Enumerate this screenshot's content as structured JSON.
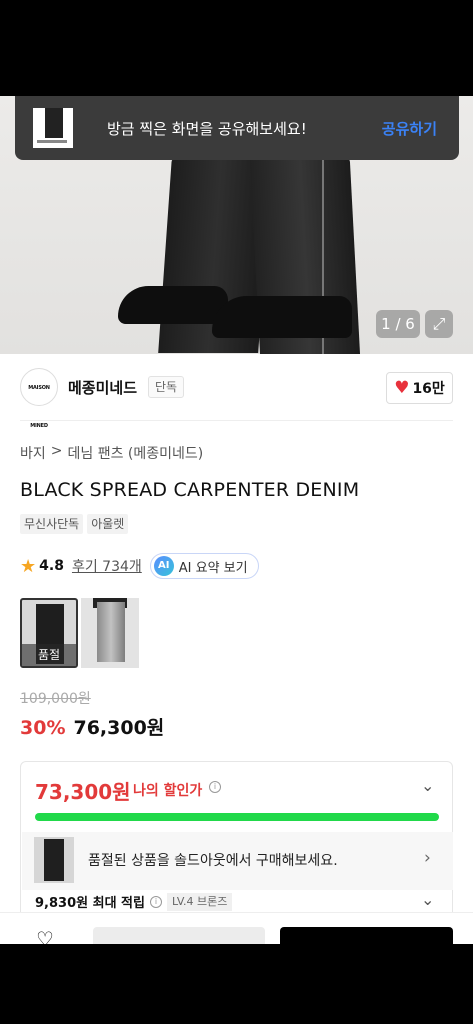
{
  "toast": {
    "message": "방금 찍은 화면을 공유해보세요!",
    "action": "공유하기"
  },
  "gallery": {
    "counter": "1 / 6",
    "expand_icon": "expand-icon"
  },
  "brand": {
    "logo_text": "MAISON MINED",
    "name": "메종미네드",
    "tag": "단독",
    "likes": "16만",
    "heart_color": "#e8323c"
  },
  "breadcrumb": {
    "items": [
      "바지",
      "데님 팬츠 (메종미네드)"
    ],
    "separator": ">"
  },
  "product": {
    "title": "BLACK SPREAD CARPENTER DENIM",
    "badges": [
      "무신사단독",
      "아울렛"
    ],
    "rating": "4.8",
    "reviews": "후기 734개",
    "ai_icon": "AI",
    "ai_label": "AI 요약 보기",
    "swatch_sold_label": "품절",
    "original_price": "109,000원",
    "discount": "30%",
    "price": "76,300원"
  },
  "benefit": {
    "my_price": "73,300원",
    "my_price_label": "나의 할인가",
    "info_icon": "i",
    "progress_color": "#21d94a",
    "soldout_message": "품절된 상품을 솔드아웃에서 구매해보세요.",
    "points": "9,830원 최대 적립",
    "level": "LV.4 브론즈"
  },
  "colors": {
    "accent_red": "#e23a3a",
    "link_blue": "#3b82f6"
  }
}
